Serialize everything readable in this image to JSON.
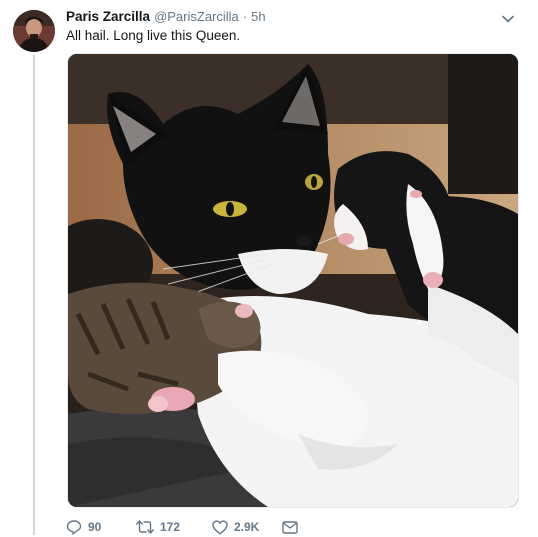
{
  "tweet": {
    "author_name": "Paris Zarcilla",
    "author_handle": "@ParisZarcilla",
    "separator": "·",
    "time": "5h",
    "text": "All hail. Long live this Queen."
  },
  "actions": {
    "replies": "90",
    "retweets": "172",
    "likes": "2.9K"
  },
  "icons": {
    "reply": "reply-icon",
    "retweet": "retweet-icon",
    "like": "heart-icon",
    "message": "envelope-icon",
    "menu": "chevron-down-icon"
  },
  "colors": {
    "text": "#14171a",
    "secondary": "#657786",
    "thread_line": "#ccd6dd"
  }
}
